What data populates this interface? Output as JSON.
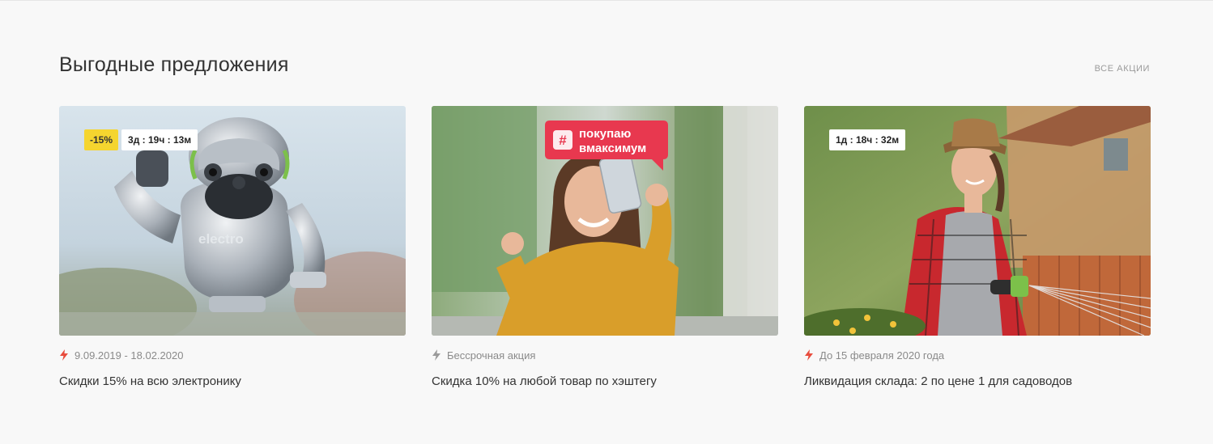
{
  "section": {
    "title": "Выгодные предложения",
    "all_link": "ВСЕ АКЦИИ"
  },
  "cards": [
    {
      "discount": "-15%",
      "timer": "3д : 19ч : 13м",
      "date": "9.09.2019 - 18.02.2020",
      "title": "Скидки 15% на всю электронику",
      "bolt_color": "#e84c3d"
    },
    {
      "discount": "",
      "timer": "",
      "image_text": {
        "hashtag_line1": "покупаю",
        "hashtag_line2": "вмаксимум",
        "hash": "#"
      },
      "date": "Бессрочная акция",
      "title": "Скидка 10% на любой товар по хэштегу",
      "bolt_color": "#9a9a9a"
    },
    {
      "discount": "",
      "timer": "1д : 18ч : 32м",
      "date": "До 15 февраля 2020 года",
      "title": "Ликвидация склада: 2 по цене 1 для садоводов",
      "bolt_color": "#e84c3d"
    }
  ],
  "robot_image_text": "electro",
  "colors": {
    "discount_badge": "#f5d52f",
    "accent": "#e84c3d",
    "hashtag_bubble": "#e8384f"
  }
}
